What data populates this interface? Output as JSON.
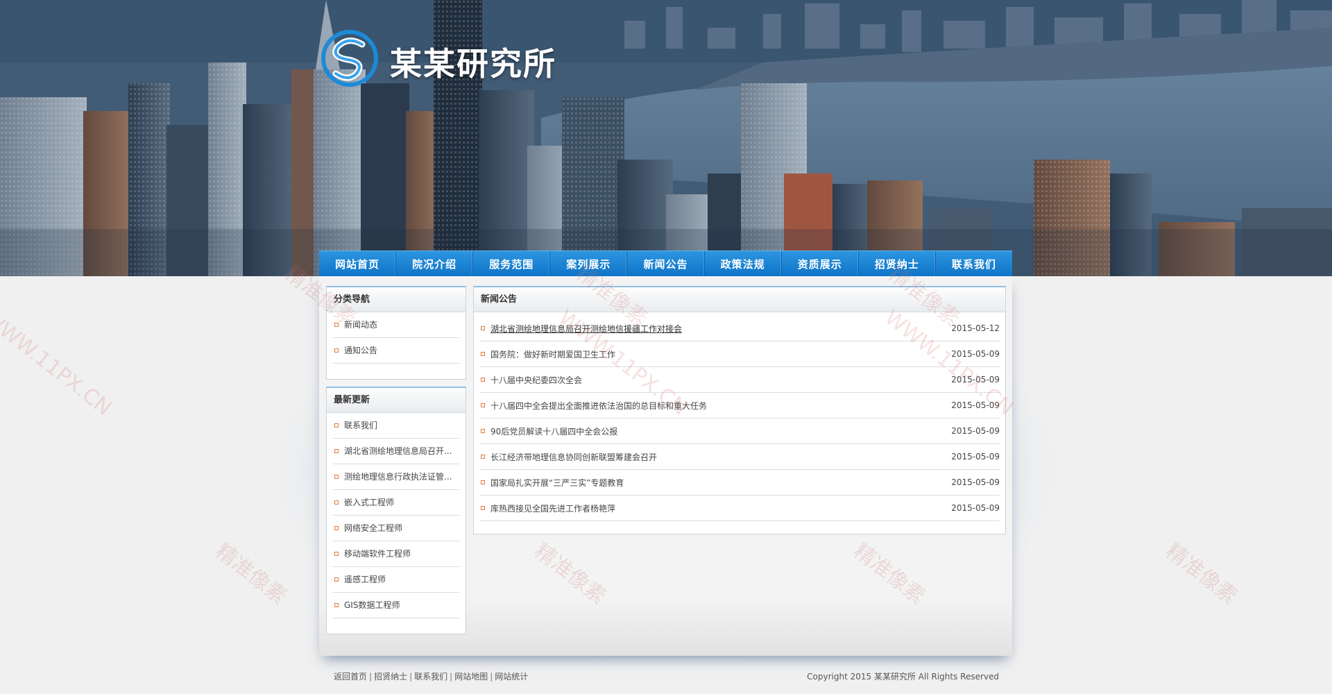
{
  "brand": {
    "name": "某某研究所",
    "logo_icon": "swirl-s-logo-icon",
    "accent": "#2c95e1"
  },
  "nav": {
    "items": [
      "网站首页",
      "院况介绍",
      "服务范围",
      "案列展示",
      "新闻公告",
      "政策法规",
      "资质展示",
      "招贤纳士",
      "联系我们"
    ]
  },
  "sidebar": {
    "category_title": "分类导航",
    "categories": [
      "新闻动态",
      "通知公告"
    ],
    "latest_title": "最新更新",
    "latest": [
      "联系我们",
      "湖北省测绘地理信息局召开...",
      "测绘地理信息行政执法证管...",
      "嵌入式工程师",
      "网络安全工程师",
      "移动端软件工程师",
      "遥感工程师",
      "GIS数据工程师"
    ]
  },
  "news": {
    "title": "新闻公告",
    "rows": [
      {
        "title": "湖北省测绘地理信息局召开测绘地信援疆工作对接会",
        "date": "2015-05-12"
      },
      {
        "title": "国务院：做好新时期爱国卫生工作",
        "date": "2015-05-09"
      },
      {
        "title": "十八届中央纪委四次全会",
        "date": "2015-05-09"
      },
      {
        "title": "十八届四中全会提出全面推进依法治国的总目标和重大任务",
        "date": "2015-05-09"
      },
      {
        "title": "90后党员解读十八届四中全会公报",
        "date": "2015-05-09"
      },
      {
        "title": "长江经济带地理信息协同创新联盟筹建会召开",
        "date": "2015-05-09"
      },
      {
        "title": "国家局扎实开展“三严三实”专题教育",
        "date": "2015-05-09"
      },
      {
        "title": "库热西接见全国先进工作者杨艳萍",
        "date": "2015-05-09"
      }
    ]
  },
  "footer": {
    "links": [
      "返回首页",
      "招贤纳士",
      "联系我们",
      "网站地图",
      "网站统计"
    ],
    "copyright": "Copyright 2015 某某研究所 All Rights Reserved"
  },
  "watermark": {
    "cn": "精准像素",
    "url": "WWW.11PX.CN"
  }
}
